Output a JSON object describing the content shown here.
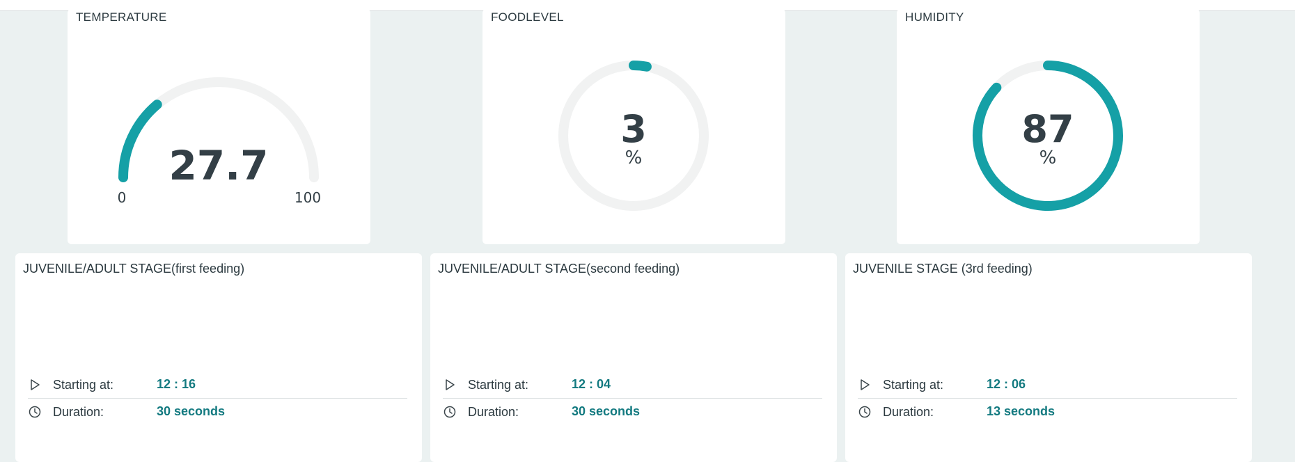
{
  "colors": {
    "accent": "#15a0a6",
    "track": "#f1f2f2",
    "value_text": "#137a80",
    "background": "#ebf1f1"
  },
  "gauges": [
    {
      "title": "TEMPERATURE",
      "value": "27.7",
      "min": "0",
      "max": "100",
      "level": 0.277
    },
    {
      "title": "FOODLEVEL",
      "value": "3",
      "unit": "%",
      "level": 0.03
    },
    {
      "title": "HUMIDITY",
      "value": "87",
      "unit": "%",
      "level": 0.87
    }
  ],
  "schedules": [
    {
      "title": "JUVENILE/ADULT STAGE(first feeding)",
      "start_label": "Starting at:",
      "start_value": "12 : 16",
      "duration_label": "Duration:",
      "duration_value": "30 seconds",
      "start_icon": "play-icon",
      "duration_icon": "clock-icon"
    },
    {
      "title": "JUVENILE/ADULT STAGE(second feeding)",
      "start_label": "Starting at:",
      "start_value": "12 : 04",
      "duration_label": "Duration:",
      "duration_value": "30 seconds",
      "start_icon": "play-icon",
      "duration_icon": "clock-icon"
    },
    {
      "title": "JUVENILE STAGE (3rd feeding)",
      "start_label": "Starting at:",
      "start_value": "12 : 06",
      "duration_label": "Duration:",
      "duration_value": "13 seconds",
      "start_icon": "play-icon",
      "duration_icon": "clock-icon"
    }
  ]
}
